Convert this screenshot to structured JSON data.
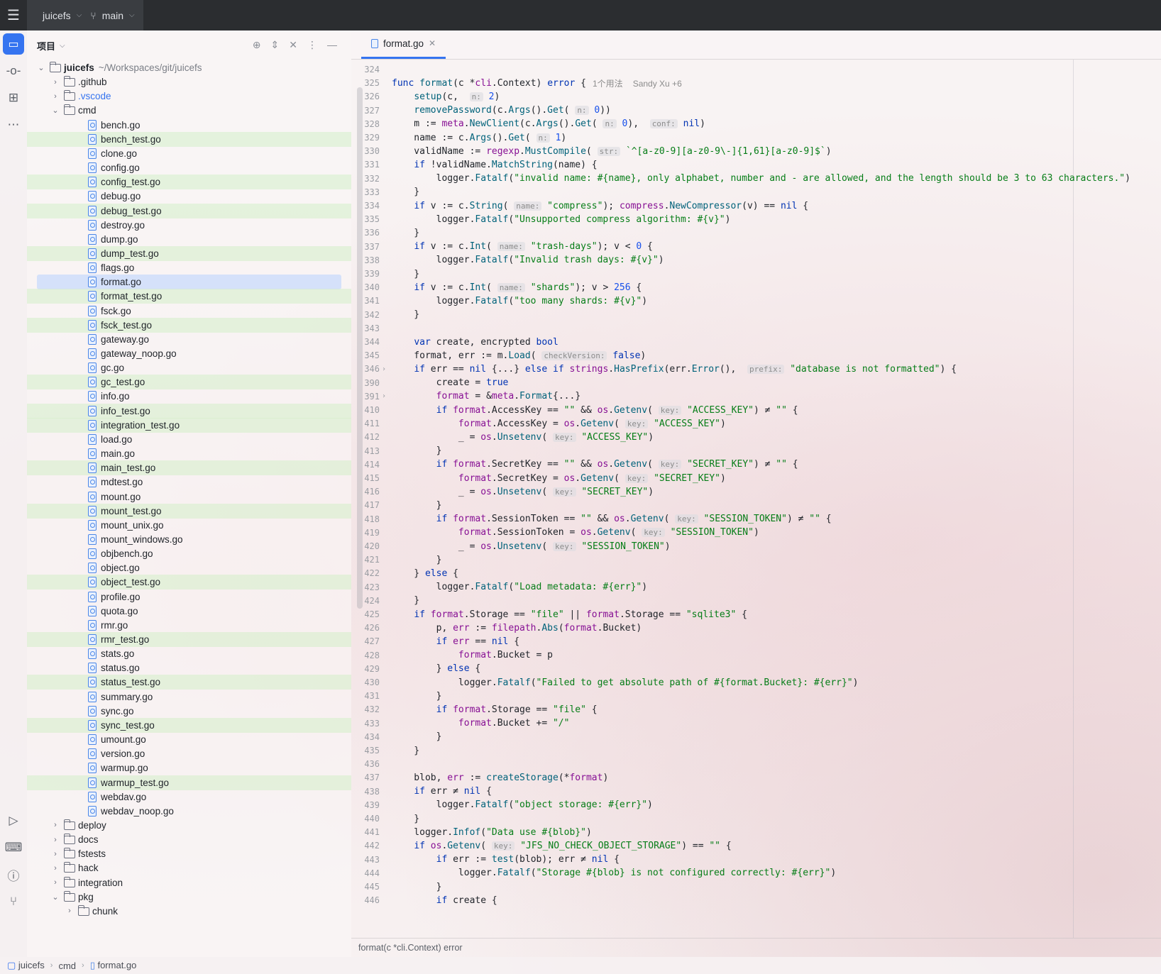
{
  "titlebar": {
    "project": "juicefs",
    "branch": "main"
  },
  "project_panel": {
    "title": "项目",
    "root": {
      "name": "juicefs",
      "path": "~/Workspaces/git/juicefs"
    },
    "items": [
      {
        "label": ".github",
        "type": "folder",
        "depth": 1,
        "expanded": false,
        "changed": false
      },
      {
        "label": ".vscode",
        "type": "folder",
        "depth": 1,
        "expanded": false,
        "changed": false,
        "color": "#3574f0"
      },
      {
        "label": "cmd",
        "type": "folder",
        "depth": 1,
        "expanded": true,
        "changed": false
      },
      {
        "label": "bench.go",
        "type": "file",
        "depth": 2,
        "changed": false
      },
      {
        "label": "bench_test.go",
        "type": "file",
        "depth": 2,
        "changed": true
      },
      {
        "label": "clone.go",
        "type": "file",
        "depth": 2,
        "changed": false
      },
      {
        "label": "config.go",
        "type": "file",
        "depth": 2,
        "changed": false
      },
      {
        "label": "config_test.go",
        "type": "file",
        "depth": 2,
        "changed": true
      },
      {
        "label": "debug.go",
        "type": "file",
        "depth": 2,
        "changed": false
      },
      {
        "label": "debug_test.go",
        "type": "file",
        "depth": 2,
        "changed": true
      },
      {
        "label": "destroy.go",
        "type": "file",
        "depth": 2,
        "changed": false
      },
      {
        "label": "dump.go",
        "type": "file",
        "depth": 2,
        "changed": false
      },
      {
        "label": "dump_test.go",
        "type": "file",
        "depth": 2,
        "changed": true
      },
      {
        "label": "flags.go",
        "type": "file",
        "depth": 2,
        "changed": false
      },
      {
        "label": "format.go",
        "type": "file",
        "depth": 2,
        "changed": false,
        "selected": true
      },
      {
        "label": "format_test.go",
        "type": "file",
        "depth": 2,
        "changed": true
      },
      {
        "label": "fsck.go",
        "type": "file",
        "depth": 2,
        "changed": false
      },
      {
        "label": "fsck_test.go",
        "type": "file",
        "depth": 2,
        "changed": true
      },
      {
        "label": "gateway.go",
        "type": "file",
        "depth": 2,
        "changed": false
      },
      {
        "label": "gateway_noop.go",
        "type": "file",
        "depth": 2,
        "changed": false
      },
      {
        "label": "gc.go",
        "type": "file",
        "depth": 2,
        "changed": false
      },
      {
        "label": "gc_test.go",
        "type": "file",
        "depth": 2,
        "changed": true
      },
      {
        "label": "info.go",
        "type": "file",
        "depth": 2,
        "changed": false
      },
      {
        "label": "info_test.go",
        "type": "file",
        "depth": 2,
        "changed": true
      },
      {
        "label": "integration_test.go",
        "type": "file",
        "depth": 2,
        "changed": true
      },
      {
        "label": "load.go",
        "type": "file",
        "depth": 2,
        "changed": false
      },
      {
        "label": "main.go",
        "type": "file",
        "depth": 2,
        "changed": false
      },
      {
        "label": "main_test.go",
        "type": "file",
        "depth": 2,
        "changed": true
      },
      {
        "label": "mdtest.go",
        "type": "file",
        "depth": 2,
        "changed": false
      },
      {
        "label": "mount.go",
        "type": "file",
        "depth": 2,
        "changed": false
      },
      {
        "label": "mount_test.go",
        "type": "file",
        "depth": 2,
        "changed": true
      },
      {
        "label": "mount_unix.go",
        "type": "file",
        "depth": 2,
        "changed": false
      },
      {
        "label": "mount_windows.go",
        "type": "file",
        "depth": 2,
        "changed": false
      },
      {
        "label": "objbench.go",
        "type": "file",
        "depth": 2,
        "changed": false
      },
      {
        "label": "object.go",
        "type": "file",
        "depth": 2,
        "changed": false
      },
      {
        "label": "object_test.go",
        "type": "file",
        "depth": 2,
        "changed": true
      },
      {
        "label": "profile.go",
        "type": "file",
        "depth": 2,
        "changed": false
      },
      {
        "label": "quota.go",
        "type": "file",
        "depth": 2,
        "changed": false
      },
      {
        "label": "rmr.go",
        "type": "file",
        "depth": 2,
        "changed": false
      },
      {
        "label": "rmr_test.go",
        "type": "file",
        "depth": 2,
        "changed": true
      },
      {
        "label": "stats.go",
        "type": "file",
        "depth": 2,
        "changed": false
      },
      {
        "label": "status.go",
        "type": "file",
        "depth": 2,
        "changed": false
      },
      {
        "label": "status_test.go",
        "type": "file",
        "depth": 2,
        "changed": true
      },
      {
        "label": "summary.go",
        "type": "file",
        "depth": 2,
        "changed": false
      },
      {
        "label": "sync.go",
        "type": "file",
        "depth": 2,
        "changed": false
      },
      {
        "label": "sync_test.go",
        "type": "file",
        "depth": 2,
        "changed": true
      },
      {
        "label": "umount.go",
        "type": "file",
        "depth": 2,
        "changed": false
      },
      {
        "label": "version.go",
        "type": "file",
        "depth": 2,
        "changed": false
      },
      {
        "label": "warmup.go",
        "type": "file",
        "depth": 2,
        "changed": false
      },
      {
        "label": "warmup_test.go",
        "type": "file",
        "depth": 2,
        "changed": true
      },
      {
        "label": "webdav.go",
        "type": "file",
        "depth": 2,
        "changed": false
      },
      {
        "label": "webdav_noop.go",
        "type": "file",
        "depth": 2,
        "changed": false
      },
      {
        "label": "deploy",
        "type": "folder",
        "depth": 1,
        "expanded": false,
        "changed": false
      },
      {
        "label": "docs",
        "type": "folder",
        "depth": 1,
        "expanded": false,
        "changed": false
      },
      {
        "label": "fstests",
        "type": "folder",
        "depth": 1,
        "expanded": false,
        "changed": false
      },
      {
        "label": "hack",
        "type": "folder",
        "depth": 1,
        "expanded": false,
        "changed": false
      },
      {
        "label": "integration",
        "type": "folder",
        "depth": 1,
        "expanded": false,
        "changed": false
      },
      {
        "label": "pkg",
        "type": "folder",
        "depth": 1,
        "expanded": true,
        "changed": false
      },
      {
        "label": "chunk",
        "type": "folder",
        "depth": 2,
        "expanded": false,
        "changed": false
      }
    ]
  },
  "editor": {
    "tab": "format.go",
    "hint_usages": "1个用法",
    "hint_author": "Sandy Xu +6",
    "lines": [
      {
        "n": "324",
        "h": ""
      },
      {
        "n": "325",
        "h": "<span class=\"kw\">func</span> <span class=\"fn\">format</span>(c *<span class=\"pkg\">cli</span>.Context) <span class=\"kw\">error</span> {"
      },
      {
        "n": "326",
        "h": "    <span class=\"fn\">setup</span>(c,  <span class=\"hint\">n:</span> <span class=\"num\">2</span>)"
      },
      {
        "n": "327",
        "h": "    <span class=\"fn\">removePassword</span>(c.<span class=\"fn\">Args</span>().<span class=\"fn\">Get</span>( <span class=\"hint\">n:</span> <span class=\"num\">0</span>))"
      },
      {
        "n": "328",
        "h": "    m := <span class=\"pkg\">meta</span>.<span class=\"fn\">NewClient</span>(c.<span class=\"fn\">Args</span>().<span class=\"fn\">Get</span>( <span class=\"hint\">n:</span> <span class=\"num\">0</span>),  <span class=\"hint\">conf:</span> <span class=\"kw\">nil</span>)"
      },
      {
        "n": "329",
        "h": "    name := c.<span class=\"fn\">Args</span>().<span class=\"fn\">Get</span>( <span class=\"hint\">n:</span> <span class=\"num\">1</span>)"
      },
      {
        "n": "330",
        "h": "    validName := <span class=\"pkg\">regexp</span>.<span class=\"fn\">MustCompile</span>( <span class=\"hint\">str:</span> <span class=\"str\">`^[a-z0-9][a-z0-9\\-]{1,61}[a-z0-9]$`</span>)"
      },
      {
        "n": "331",
        "h": "    <span class=\"kw\">if</span> !validName.<span class=\"fn\">MatchString</span>(name) {"
      },
      {
        "n": "332",
        "h": "        logger.<span class=\"fn\">Fatalf</span>(<span class=\"str\">\"invalid name: #{name}, only alphabet, number and - are allowed, and the length should be 3 to 63 characters.\"</span>)"
      },
      {
        "n": "333",
        "h": "    }"
      },
      {
        "n": "334",
        "h": "    <span class=\"kw\">if</span> v := c.<span class=\"fn\">String</span>( <span class=\"hint\">name:</span> <span class=\"str\">\"compress\"</span>); <span class=\"pkg\">compress</span>.<span class=\"fn\">NewCompressor</span>(v) == <span class=\"kw\">nil</span> {"
      },
      {
        "n": "335",
        "h": "        logger.<span class=\"fn\">Fatalf</span>(<span class=\"str\">\"Unsupported compress algorithm: #{v}\"</span>)"
      },
      {
        "n": "336",
        "h": "    }"
      },
      {
        "n": "337",
        "h": "    <span class=\"kw\">if</span> v := c.<span class=\"fn\">Int</span>( <span class=\"hint\">name:</span> <span class=\"str\">\"trash-days\"</span>); v &lt; <span class=\"num\">0</span> {"
      },
      {
        "n": "338",
        "h": "        logger.<span class=\"fn\">Fatalf</span>(<span class=\"str\">\"Invalid trash days: #{v}\"</span>)"
      },
      {
        "n": "339",
        "h": "    }"
      },
      {
        "n": "340",
        "h": "    <span class=\"kw\">if</span> v := c.<span class=\"fn\">Int</span>( <span class=\"hint\">name:</span> <span class=\"str\">\"shards\"</span>); v &gt; <span class=\"num\">256</span> {"
      },
      {
        "n": "341",
        "h": "        logger.<span class=\"fn\">Fatalf</span>(<span class=\"str\">\"too many shards: #{v}\"</span>)"
      },
      {
        "n": "342",
        "h": "    }"
      },
      {
        "n": "343",
        "h": ""
      },
      {
        "n": "344",
        "h": "    <span class=\"kw\">var</span> create, encrypted <span class=\"kw\">bool</span>"
      },
      {
        "n": "345",
        "h": "    format, err := m.<span class=\"fn\">Load</span>( <span class=\"hint\">checkVersion:</span> <span class=\"kw\">false</span>)"
      },
      {
        "n": "346",
        "h": "    <span class=\"kw\">if</span> err == <span class=\"kw\">nil</span> {...} <span class=\"kw\">else if</span> <span class=\"pkg\">strings</span>.<span class=\"fn\">HasPrefix</span>(err.<span class=\"fn\">Error</span>(),  <span class=\"hint\">prefix:</span> <span class=\"str\">\"database is not formatted\"</span>) {"
      },
      {
        "n": "390",
        "h": "        create = <span class=\"kw\">true</span>"
      },
      {
        "n": "391",
        "h": "        <span class=\"pkg\">format</span> = &amp;<span class=\"pkg\">meta</span>.<span class=\"fn\">Format</span>{...}"
      },
      {
        "n": "410",
        "h": "        <span class=\"kw\">if</span> <span class=\"pkg\">format</span>.AccessKey == <span class=\"str\">\"\"</span> &amp;&amp; <span class=\"pkg\">os</span>.<span class=\"fn\">Getenv</span>( <span class=\"hint\">key:</span> <span class=\"str\">\"ACCESS_KEY\"</span>) ≠ <span class=\"str\">\"\"</span> {"
      },
      {
        "n": "411",
        "h": "            <span class=\"pkg\">format</span>.AccessKey = <span class=\"pkg\">os</span>.<span class=\"fn\">Getenv</span>( <span class=\"hint\">key:</span> <span class=\"str\">\"ACCESS_KEY\"</span>)"
      },
      {
        "n": "412",
        "h": "            _ = <span class=\"pkg\">os</span>.<span class=\"fn\">Unsetenv</span>( <span class=\"hint\">key:</span> <span class=\"str\">\"ACCESS_KEY\"</span>)"
      },
      {
        "n": "413",
        "h": "        }"
      },
      {
        "n": "414",
        "h": "        <span class=\"kw\">if</span> <span class=\"pkg\">format</span>.SecretKey == <span class=\"str\">\"\"</span> &amp;&amp; <span class=\"pkg\">os</span>.<span class=\"fn\">Getenv</span>( <span class=\"hint\">key:</span> <span class=\"str\">\"SECRET_KEY\"</span>) ≠ <span class=\"str\">\"\"</span> {"
      },
      {
        "n": "415",
        "h": "            <span class=\"pkg\">format</span>.SecretKey = <span class=\"pkg\">os</span>.<span class=\"fn\">Getenv</span>( <span class=\"hint\">key:</span> <span class=\"str\">\"SECRET_KEY\"</span>)"
      },
      {
        "n": "416",
        "h": "            _ = <span class=\"pkg\">os</span>.<span class=\"fn\">Unsetenv</span>( <span class=\"hint\">key:</span> <span class=\"str\">\"SECRET_KEY\"</span>)"
      },
      {
        "n": "417",
        "h": "        }"
      },
      {
        "n": "418",
        "h": "        <span class=\"kw\">if</span> <span class=\"pkg\">format</span>.SessionToken == <span class=\"str\">\"\"</span> &amp;&amp; <span class=\"pkg\">os</span>.<span class=\"fn\">Getenv</span>( <span class=\"hint\">key:</span> <span class=\"str\">\"SESSION_TOKEN\"</span>) ≠ <span class=\"str\">\"\"</span> {"
      },
      {
        "n": "419",
        "h": "            <span class=\"pkg\">format</span>.SessionToken = <span class=\"pkg\">os</span>.<span class=\"fn\">Getenv</span>( <span class=\"hint\">key:</span> <span class=\"str\">\"SESSION_TOKEN\"</span>)"
      },
      {
        "n": "420",
        "h": "            _ = <span class=\"pkg\">os</span>.<span class=\"fn\">Unsetenv</span>( <span class=\"hint\">key:</span> <span class=\"str\">\"SESSION_TOKEN\"</span>)"
      },
      {
        "n": "421",
        "h": "        }"
      },
      {
        "n": "422",
        "h": "    } <span class=\"kw\">else</span> {"
      },
      {
        "n": "423",
        "h": "        logger.<span class=\"fn\">Fatalf</span>(<span class=\"str\">\"Load metadata: #{err}\"</span>)"
      },
      {
        "n": "424",
        "h": "    }"
      },
      {
        "n": "425",
        "h": "    <span class=\"kw\">if</span> <span class=\"pkg\">format</span>.Storage == <span class=\"str\">\"file\"</span> || <span class=\"pkg\">format</span>.Storage == <span class=\"str\">\"sqlite3\"</span> {"
      },
      {
        "n": "426",
        "h": "        p, <span class=\"pkg\">err</span> := <span class=\"pkg\">filepath</span>.<span class=\"fn\">Abs</span>(<span class=\"pkg\">format</span>.Bucket)"
      },
      {
        "n": "427",
        "h": "        <span class=\"kw\">if</span> <span class=\"pkg\">err</span> == <span class=\"kw\">nil</span> {"
      },
      {
        "n": "428",
        "h": "            <span class=\"pkg\">format</span>.Bucket = p"
      },
      {
        "n": "429",
        "h": "        } <span class=\"kw\">else</span> {"
      },
      {
        "n": "430",
        "h": "            logger.<span class=\"fn\">Fatalf</span>(<span class=\"str\">\"Failed to get absolute path of #{format.Bucket}: #{err}\"</span>)"
      },
      {
        "n": "431",
        "h": "        }"
      },
      {
        "n": "432",
        "h": "        <span class=\"kw\">if</span> <span class=\"pkg\">format</span>.Storage == <span class=\"str\">\"file\"</span> {"
      },
      {
        "n": "433",
        "h": "            <span class=\"pkg\">format</span>.Bucket += <span class=\"str\">\"/\"</span>"
      },
      {
        "n": "434",
        "h": "        }"
      },
      {
        "n": "435",
        "h": "    }"
      },
      {
        "n": "436",
        "h": ""
      },
      {
        "n": "437",
        "h": "    blob, <span class=\"pkg\">err</span> := <span class=\"fn\">createStorage</span>(*<span class=\"pkg\">format</span>)"
      },
      {
        "n": "438",
        "h": "    <span class=\"kw\">if</span> err ≠ <span class=\"kw\">nil</span> {"
      },
      {
        "n": "439",
        "h": "        logger.<span class=\"fn\">Fatalf</span>(<span class=\"str\">\"object storage: #{err}\"</span>)"
      },
      {
        "n": "440",
        "h": "    }"
      },
      {
        "n": "441",
        "h": "    logger.<span class=\"fn\">Infof</span>(<span class=\"str\">\"Data use #{blob}\"</span>)"
      },
      {
        "n": "442",
        "h": "    <span class=\"kw\">if</span> <span class=\"pkg\">os</span>.<span class=\"fn\">Getenv</span>( <span class=\"hint\">key:</span> <span class=\"str\">\"JFS_NO_CHECK_OBJECT_STORAGE\"</span>) == <span class=\"str\">\"\"</span> {"
      },
      {
        "n": "443",
        "h": "        <span class=\"kw\">if</span> err := <span class=\"fn\">test</span>(blob); err ≠ <span class=\"kw\">nil</span> {"
      },
      {
        "n": "444",
        "h": "            logger.<span class=\"fn\">Fatalf</span>(<span class=\"str\">\"Storage #{blob} is not configured correctly: #{err}\"</span>)"
      },
      {
        "n": "445",
        "h": "        }"
      },
      {
        "n": "446",
        "h": "        <span class=\"kw\">if</span> create {"
      }
    ],
    "bottom_crumb": "format(c *cli.Context) error"
  },
  "statusbar": {
    "crumbs": [
      "juicefs",
      "cmd",
      "format.go"
    ]
  },
  "colors": {
    "accent": "#3574f0",
    "changed_bg": "#d4eec8",
    "selected_bg": "#d5e1fa"
  }
}
